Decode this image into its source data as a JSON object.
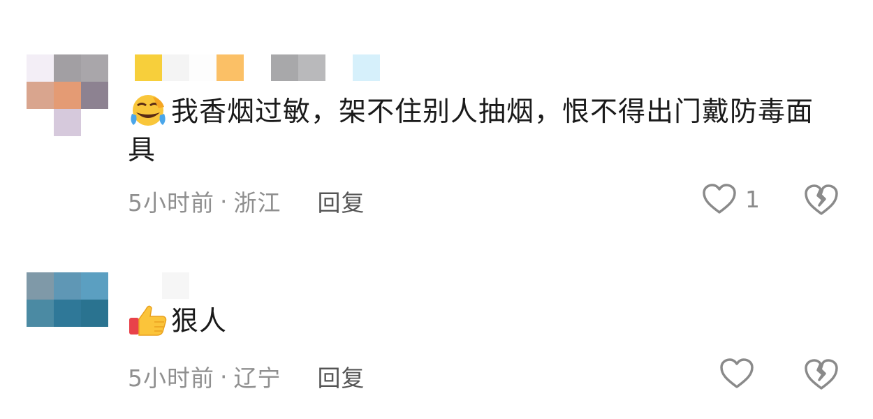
{
  "comments": [
    {
      "avatar_colors": [
        "#f3eef6",
        "#a29fa3",
        "#a9a6aa",
        "#d9a58e",
        "#e49b74",
        "#8d8291",
        "#ffffff",
        "#d6c9dc",
        "#ffffff"
      ],
      "username_colors": [
        "#f7cf3b",
        "#f4f4f4",
        "#fdfdfd",
        "#fbc066",
        "#ffffff",
        "#a8a8aa",
        "#b9b9bb",
        "#ffffff",
        "#d6f0fb"
      ],
      "emoji": "laughing-tears-emoji",
      "text": "我香烟过敏，架不住别人抽烟，恨不得出门戴防毒面具",
      "time": "5小时前",
      "separator": "·",
      "location": "浙江",
      "reply_label": "回复",
      "like_count": "1"
    },
    {
      "avatar_colors": [
        "#7f99a8",
        "#5f97b5",
        "#5b9fc1",
        "#4b8aa3",
        "#2f7898",
        "#2a7390",
        "#ffffff",
        "#ffffff",
        "#ffffff"
      ],
      "username_colors": [
        "#ffffff",
        "#f6f6f6",
        "#ffffff"
      ],
      "emoji": "thumbs-up-emoji",
      "text": "狠人",
      "time": "5小时前",
      "separator": "·",
      "location": "辽宁",
      "reply_label": "回复",
      "like_count": ""
    }
  ],
  "colors": {
    "text": "#1a1a1a",
    "meta": "#8f8f8f",
    "reply": "#555555",
    "icon": "#8a8a8a"
  }
}
